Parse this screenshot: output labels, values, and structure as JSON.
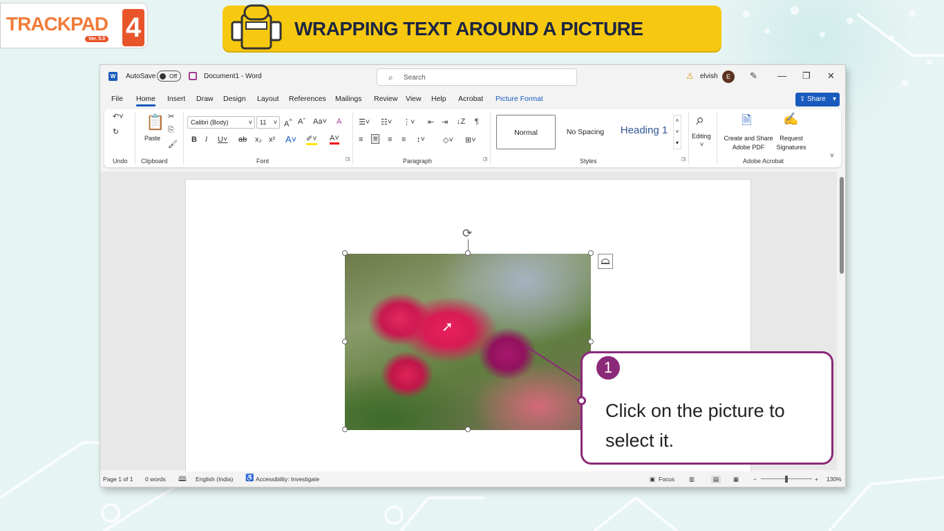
{
  "brand": {
    "logo_text": "TRACKPAD",
    "logo_version": "Ver. 5.0",
    "logo_number": "4"
  },
  "banner": {
    "title": "WRAPPING TEXT AROUND A PICTURE"
  },
  "titlebar": {
    "app_icon": "W",
    "autosave_label": "AutoSave",
    "autosave_state": "Off",
    "document_title": "Document1  -  Word",
    "search_placeholder": "Search",
    "user_name": "elvish",
    "user_initial": "E"
  },
  "tabs": [
    {
      "label": "File"
    },
    {
      "label": "Home",
      "active": true
    },
    {
      "label": "Insert"
    },
    {
      "label": "Draw"
    },
    {
      "label": "Design"
    },
    {
      "label": "Layout"
    },
    {
      "label": "References"
    },
    {
      "label": "Mailings"
    },
    {
      "label": "Review"
    },
    {
      "label": "View"
    },
    {
      "label": "Help"
    },
    {
      "label": "Acrobat"
    },
    {
      "label": "Picture Format"
    }
  ],
  "share_label": "Share",
  "ribbon": {
    "groups": {
      "undo": "Undo",
      "clipboard": "Clipboard",
      "font": "Font",
      "paragraph": "Paragraph",
      "styles": "Styles",
      "adobe": "Adobe Acrobat"
    },
    "paste_label": "Paste",
    "font_name": "Calibri (Body)",
    "font_size": "11",
    "styles": {
      "normal": "Normal",
      "no_spacing": "No Spacing",
      "heading1": "Heading 1"
    },
    "editing_label": "Editing",
    "create_share": "Create and Share Adobe PDF",
    "request_signatures": "Request Signatures"
  },
  "statusbar": {
    "page": "Page 1 of 1",
    "words": "0 words",
    "language": "English (India)",
    "accessibility": "Accessibility: Investigate",
    "focus": "Focus",
    "zoom": "130%"
  },
  "callout": {
    "step": "1",
    "text": "Click on the picture to select it."
  }
}
